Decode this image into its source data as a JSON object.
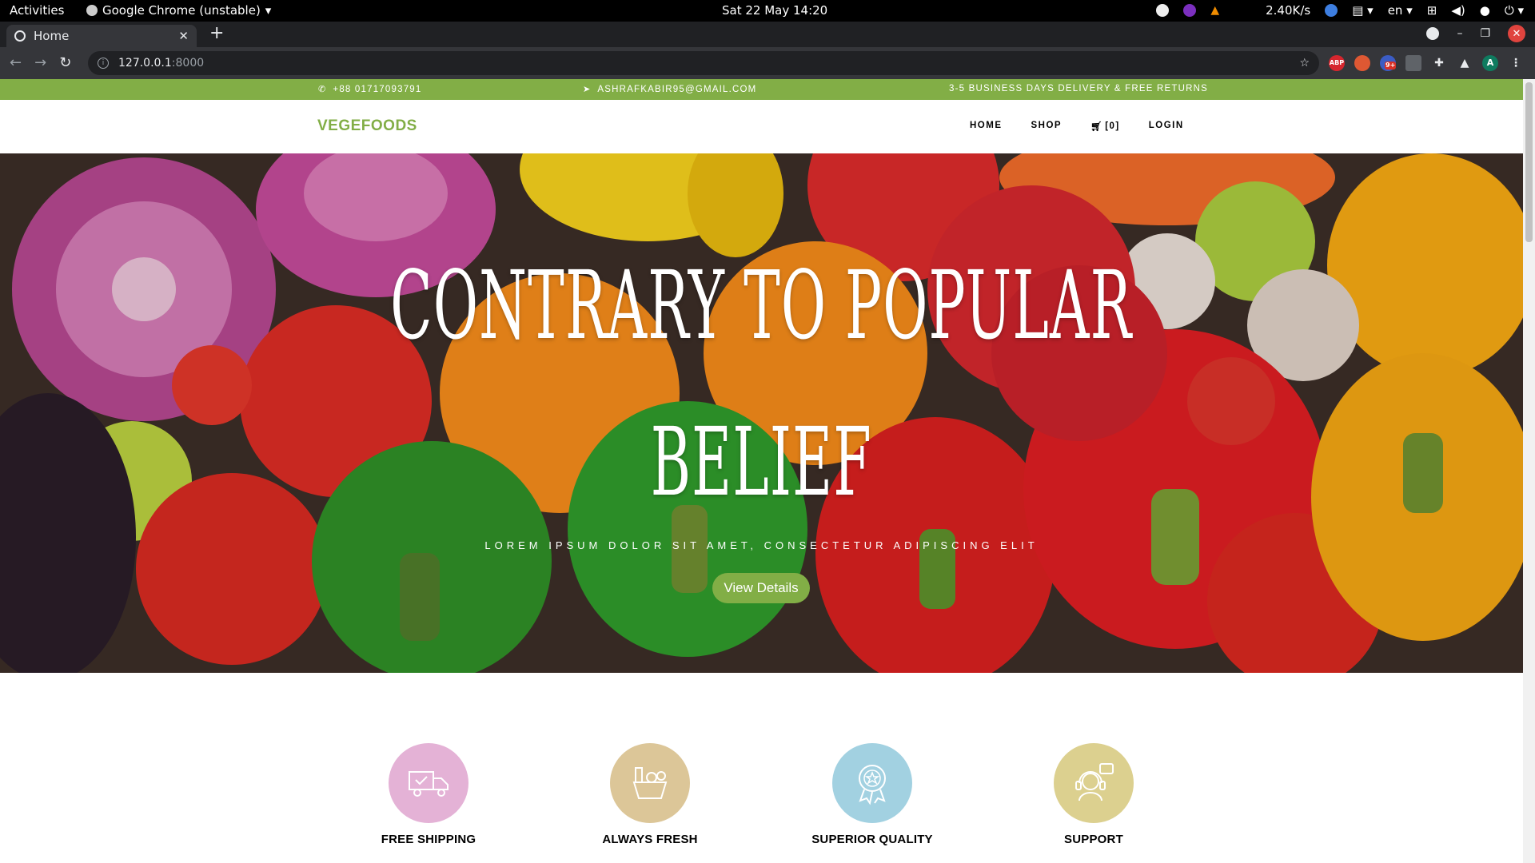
{
  "os": {
    "activities": "Activities",
    "app_name": "Google Chrome (unstable)",
    "clock": "Sat 22 May  14:20",
    "net_speed": "2.40K/s",
    "lang": "en"
  },
  "browser": {
    "tab_title": "Home",
    "url_host": "127.0.0.1",
    "url_port": ":8000",
    "ext_badge": "9+"
  },
  "site": {
    "phone": "+88 01717093791",
    "email": "ASHRAFKABIR95@GMAIL.COM",
    "delivery": "3-5 BUSINESS DAYS DELIVERY & FREE RETURNS",
    "logo": "VEGEFOODS",
    "nav": {
      "home": "HOME",
      "shop": "SHOP",
      "cart": "[0]",
      "login": "LOGIN"
    },
    "hero": {
      "title_line1": "Contrary to popular",
      "title_line2": "belief",
      "subtitle": "LOREM IPSUM DOLOR SIT AMET, CONSECTETUR ADIPISCING ELIT",
      "button": "View Details"
    },
    "services": [
      {
        "label": "FREE SHIPPING",
        "icon": "truck-icon",
        "color": "#e4b2d6"
      },
      {
        "label": "ALWAYS FRESH",
        "icon": "basket-icon",
        "color": "#dcc698"
      },
      {
        "label": "SUPERIOR QUALITY",
        "icon": "award-icon",
        "color": "#a2d1e1"
      },
      {
        "label": "SUPPORT",
        "icon": "headset-icon",
        "color": "#dcd08f"
      }
    ]
  },
  "colors": {
    "brand_green": "#82ae46",
    "chrome_dark": "#202124",
    "chrome_toolbar": "#35363a"
  }
}
